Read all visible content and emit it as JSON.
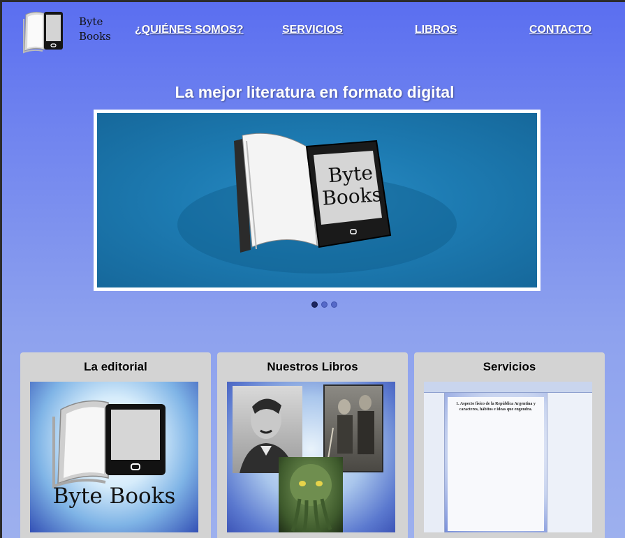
{
  "brand": {
    "logo_line1": "Byte",
    "logo_line2": "Books",
    "logo_icon": "book-tablet-icon"
  },
  "nav": {
    "items": [
      {
        "label": "¿QUIÉNES SOMOS?"
      },
      {
        "label": "SERVICIOS"
      },
      {
        "label": "LIBROS"
      },
      {
        "label": "CONTACTO"
      }
    ]
  },
  "hero": {
    "title": "La mejor literatura en formato digital",
    "slide_text_line1": "Byte",
    "slide_text_line2": "Books",
    "slide_count": 3,
    "active_slide": 1
  },
  "cards": [
    {
      "title": "La editorial",
      "image_text": "Byte Books"
    },
    {
      "title": "Nuestros Libros"
    },
    {
      "title": "Servicios",
      "image_heading": "1. Aspecto físico de la República Argentina y caracteres, hábitos e ideas que engendra."
    }
  ],
  "colors": {
    "background_top": "#5a6ef0",
    "background_bottom": "#9db0ee",
    "card_bg": "#d3d3d3",
    "slide_bg": "#1d7bb2",
    "nav_text": "#ffffff"
  }
}
